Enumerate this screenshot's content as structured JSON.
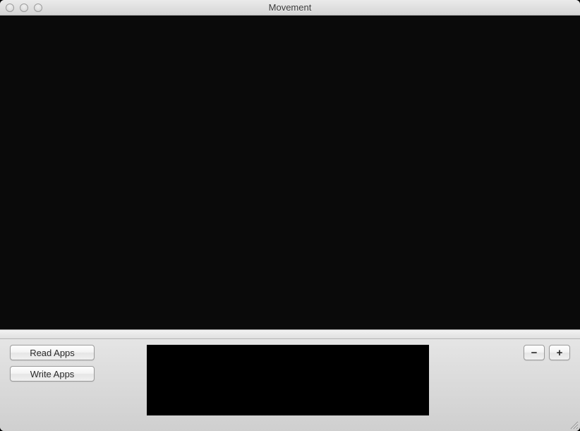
{
  "window": {
    "title": "Movement"
  },
  "buttons": {
    "read_apps": "Read Apps",
    "write_apps": "Write Apps",
    "minus": "−",
    "plus": "+"
  }
}
